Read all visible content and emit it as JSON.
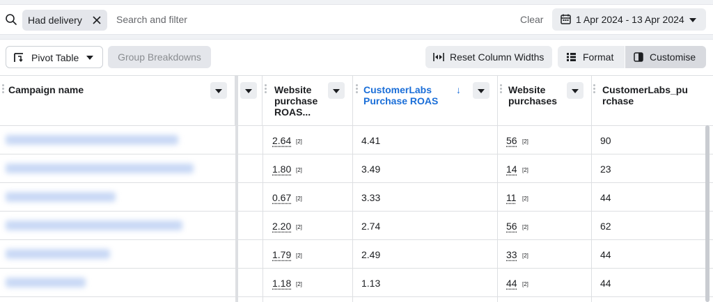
{
  "filters": {
    "chip_label": "Had delivery",
    "search_placeholder": "Search and filter",
    "clear_label": "Clear",
    "date_range": "1 Apr 2024 - 13 Apr 2024"
  },
  "toolbar": {
    "pivot_label": "Pivot Table",
    "group_label": "Group Breakdowns",
    "reset_label": "Reset Column Widths",
    "format_label": "Format",
    "customise_label": "Customise"
  },
  "columns": {
    "campaign": "Campaign name",
    "web_roas": [
      "Website",
      "purchase",
      "ROAS..."
    ],
    "cl_roas": [
      "CustomerLabs",
      "Purchase ROAS"
    ],
    "web_purch": [
      "Website",
      "purchases"
    ],
    "cl_purch": [
      "CustomerLabs_pu",
      "rchase"
    ],
    "sort_arrow": "↓"
  },
  "rows": [
    {
      "web_roas": "2.64",
      "cl_roas": "4.41",
      "web_purch": "56",
      "cl_purch": "90"
    },
    {
      "web_roas": "1.80",
      "cl_roas": "3.49",
      "web_purch": "14",
      "cl_purch": "23"
    },
    {
      "web_roas": "0.67",
      "cl_roas": "3.33",
      "web_purch": "11",
      "cl_purch": "44"
    },
    {
      "web_roas": "2.20",
      "cl_roas": "2.74",
      "web_purch": "56",
      "cl_purch": "62"
    },
    {
      "web_roas": "1.79",
      "cl_roas": "2.49",
      "web_purch": "33",
      "cl_purch": "44"
    },
    {
      "web_roas": "1.18",
      "cl_roas": "1.13",
      "web_purch": "44",
      "cl_purch": "44"
    }
  ],
  "footnote_marker": "[2]",
  "colors": {
    "accent": "#1a6ed8",
    "background": "#f0f2f5"
  }
}
